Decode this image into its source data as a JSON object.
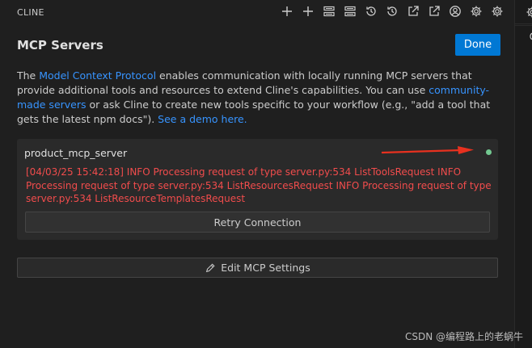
{
  "topbar": {
    "title": "CLINE",
    "icons": [
      "plus-icon",
      "plus-icon",
      "server-icon",
      "server-icon",
      "history-icon",
      "history-icon",
      "external-link-icon",
      "external-link-icon",
      "account-icon",
      "settings-icon",
      "settings-icon"
    ]
  },
  "header": {
    "title": "MCP Servers",
    "done_label": "Done"
  },
  "intro": {
    "part1": "The ",
    "link1": "Model Context Protocol",
    "part2": " enables communication with locally running MCP servers that provide additional tools and resources to extend Cline's capabilities. You can use ",
    "link2": "community-made servers",
    "part3": " or ask Cline to create new tools specific to your workflow (e.g., \"add a tool that gets the latest npm docs\"). ",
    "link3": "See a demo here."
  },
  "server": {
    "name": "product_mcp_server",
    "status_color": "#73c991",
    "log": "[04/03/25 15:42:18] INFO Processing request of type server.py:534 ListToolsRequest INFO Processing request of type server.py:534 ListResourcesRequest INFO Processing request of type server.py:534 ListResourceTemplatesRequest",
    "retry_label": "Retry Connection"
  },
  "edit": {
    "label": "Edit MCP Settings"
  },
  "watermark": "CSDN @编程路上的老蜗牛",
  "colors": {
    "accent": "#0078d4",
    "link": "#3794ff",
    "error": "#f14c4c",
    "status_ok": "#73c991",
    "annotation_arrow": "#e8311f"
  }
}
